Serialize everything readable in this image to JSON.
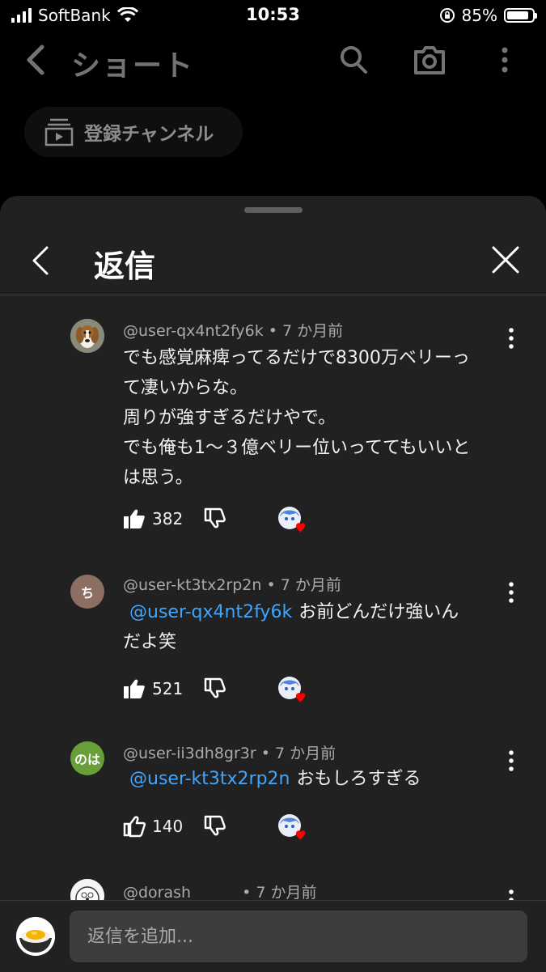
{
  "status": {
    "carrier": "SoftBank",
    "time": "10:53",
    "battery": "85%",
    "battery_level": 0.85
  },
  "app": {
    "title": "ショート",
    "chip_label": "登録チャンネル"
  },
  "sheet": {
    "title": "返信"
  },
  "comments": [
    {
      "author": "@user-qx4nt2fy6k",
      "age": "7 か月前",
      "lines": [
        "でも感覚麻痺ってるだけで8300万ベリーっ",
        "て凄いからな。",
        "周りが強すぎるだけやで。",
        "でも俺も1〜３億ベリー位いっててもいいと",
        "は思う。"
      ],
      "likes": "382",
      "avatar_icon": "beagle-dog-avatar"
    },
    {
      "author": "@user-kt3tx2rp2n",
      "age": "7 か月前",
      "mention": "@user-qx4nt2fy6k",
      "text_after_mention": "お前どんだけ強いん",
      "line2": "だよ笑",
      "likes": "521",
      "avatar_text": "ち",
      "avatar_color": "#8d6e63"
    },
    {
      "author": "@user-ii3dh8gr3r",
      "age": "7 か月前",
      "mention": "@user-kt3tx2rp2n",
      "text_after_mention": "おもしろすぎる",
      "likes": "140",
      "avatar_text": "のは",
      "avatar_color": "#689f38"
    },
    {
      "author": "@dorash______",
      "age": "7 か月前"
    }
  ],
  "composer": {
    "placeholder": "返信を追加..."
  },
  "colors": {
    "sheet_bg": "#212121",
    "mention": "#3ea6ff",
    "heart": "#ff0000"
  }
}
